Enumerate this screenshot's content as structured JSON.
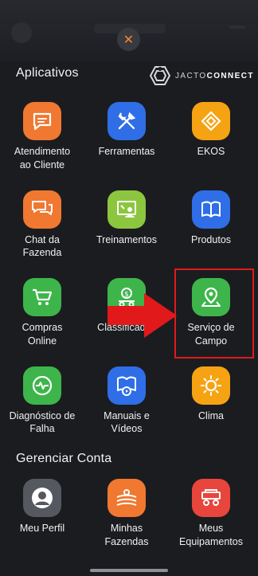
{
  "close_glyph": "✕",
  "sections": {
    "apps_title": "Aplicativos",
    "account_title": "Gerenciar Conta"
  },
  "brand": {
    "prefix": "JACTO",
    "suffix": "CONNECT"
  },
  "apps": [
    {
      "label": "Atendimento\nao Cliente",
      "icon": "chat-icon",
      "color": "#f07830"
    },
    {
      "label": "Ferramentas",
      "icon": "tools-icon",
      "color": "#2f6ee6"
    },
    {
      "label": "EKOS",
      "icon": "diamond-icon",
      "color": "#f5a313"
    },
    {
      "label": "Chat da\nFazenda",
      "icon": "chat-bubbles-icon",
      "color": "#f07830"
    },
    {
      "label": "Treinamentos",
      "icon": "training-icon",
      "color": "#8cc63f"
    },
    {
      "label": "Produtos",
      "icon": "book-icon",
      "color": "#2f6ee6"
    },
    {
      "label": "Compras\nOnline",
      "icon": "cart-icon",
      "color": "#3db54a"
    },
    {
      "label": "Classificados",
      "icon": "money-tractor-icon",
      "color": "#3db54a"
    },
    {
      "label": "Serviço de\nCampo",
      "icon": "map-pin-icon",
      "color": "#3db54a"
    },
    {
      "label": "Diagnóstico de\nFalha",
      "icon": "diagnostic-icon",
      "color": "#3db54a"
    },
    {
      "label": "Manuais e\nVídeos",
      "icon": "manual-video-icon",
      "color": "#2f6ee6"
    },
    {
      "label": "Clima",
      "icon": "sun-icon",
      "color": "#f5a313"
    }
  ],
  "account": [
    {
      "label": "Meu Perfil",
      "icon": "profile-icon",
      "color": "#55585f"
    },
    {
      "label": "Minhas\nFazendas",
      "icon": "farm-icon",
      "color": "#f07830"
    },
    {
      "label": "Meus\nEquipamentos",
      "icon": "equipment-icon",
      "color": "#e8453c"
    }
  ],
  "annotation_colors": {
    "highlight": "#e1191b"
  }
}
